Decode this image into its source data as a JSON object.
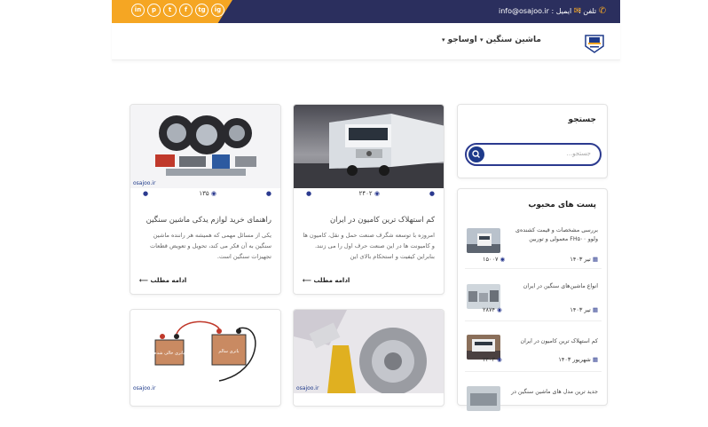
{
  "topbar": {
    "phone_label": "تلفن :",
    "email_label": "ایمیل :",
    "email": "info@osajoo.ir",
    "social": [
      "in",
      "p",
      "t",
      "f",
      "tg",
      "ig"
    ]
  },
  "nav": {
    "items": [
      {
        "label": "ماشین سنگین"
      },
      {
        "label": "اوساجو"
      }
    ]
  },
  "sidebar": {
    "search_title": "جستجو",
    "search_placeholder": "جستجو...",
    "popular_title": "پست های محبوب",
    "posts": [
      {
        "title": "بررسی مشخصات و قیمت کشنده‌ی ولوو FH۵۰۰ معمولی و توربین",
        "date": "تیر ۱۴۰۳",
        "views": "۱۵۰۰۷"
      },
      {
        "title": "انواع ماشین‌های سنگین در ایران",
        "date": "تیر ۱۴۰۳",
        "views": "۲۸۷۴"
      },
      {
        "title": "کم استهلاک ترین کامیون در ایران",
        "date": "شهریور ۱۴۰۳",
        "views": "۲۴۰۳"
      },
      {
        "title": "جدید ترین مدل های ماشین سنگین در",
        "date": "",
        "views": ""
      }
    ]
  },
  "cards": [
    {
      "views": "۲۴۰۲",
      "title": "کم استهلاک ترین کامیون در ایران",
      "excerpt": "امروزه با توسعه شگرف صنعت حمل و نقل، کامیون ها و کامیونت ها در این صنعت حرف اول را می زنند. بنابراین کیفیت و استحکام بالای این",
      "more": "ادامه مطلب"
    },
    {
      "views": "۱۳۵",
      "title": "راهنمای خرید لوازم یدکی ماشین سنگین",
      "excerpt": "یکی از مسائل مهمی که همیشه هر راننده ماشین سنگین به آن فکر می کند، تحویل و تعویض قطعات تجهیزات سنگین است.",
      "more": "ادامه مطلب",
      "watermark": "osajoo.ir"
    },
    {
      "watermark": "osajoo.ir"
    },
    {
      "watermark": "osajoo.ir",
      "battery_left": "باتری خالی شده",
      "battery_right": "باتری سالم"
    }
  ]
}
